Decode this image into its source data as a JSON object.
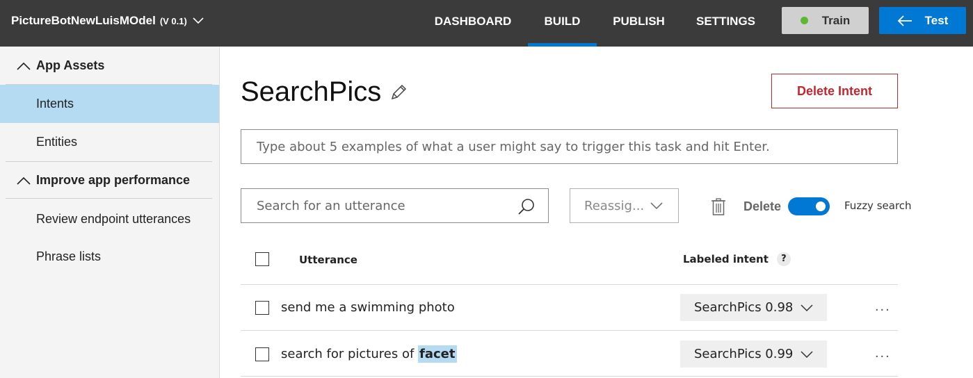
{
  "header": {
    "app_name": "PictureBotNewLuisMOdel",
    "version": "(V 0.1)",
    "nav": [
      {
        "label": "DASHBOARD"
      },
      {
        "label": "BUILD"
      },
      {
        "label": "PUBLISH"
      },
      {
        "label": "SETTINGS"
      }
    ],
    "train_label": "Train",
    "test_label": "Test",
    "colors": {
      "bar": "#3b3b3b",
      "accent": "#0078d4",
      "train_dot": "#5cb82e"
    }
  },
  "sidebar": {
    "groups": [
      {
        "label": "App Assets",
        "items": [
          {
            "label": "Intents"
          },
          {
            "label": "Entities"
          }
        ]
      },
      {
        "label": "Improve app performance",
        "items": [
          {
            "label": "Review endpoint utterances"
          },
          {
            "label": "Phrase lists"
          }
        ]
      }
    ]
  },
  "main": {
    "title": "SearchPics",
    "delete_intent_label": "Delete Intent",
    "utterance_placeholder": "Type about 5 examples of what a user might say to trigger this task and hit Enter.",
    "search_placeholder": "Search for an utterance",
    "reassign_label": "Reassig...",
    "delete_label": "Delete",
    "fuzzy_label": "Fuzzy search",
    "table": {
      "col_utterance": "Utterance",
      "col_intent": "Labeled intent",
      "help": "?",
      "rows": [
        {
          "text": "send me a swimming photo",
          "entity": "",
          "intent": "SearchPics 0.98"
        },
        {
          "text": "search for pictures of ",
          "entity": "facet",
          "intent": "SearchPics 0.99"
        }
      ],
      "more": "..."
    }
  }
}
